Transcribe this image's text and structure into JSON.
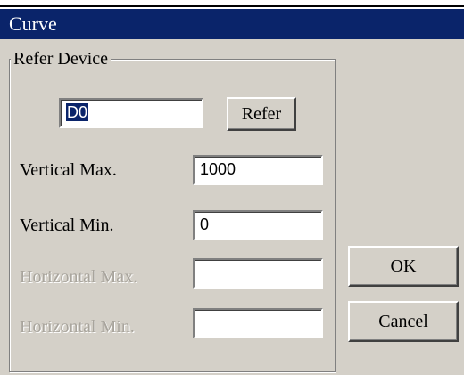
{
  "window": {
    "title": "Curve"
  },
  "refer_group": {
    "legend": "Refer Device",
    "device_value": "D0",
    "refer_button": "Refer"
  },
  "fields": {
    "vertical_max": {
      "label": "Vertical Max.",
      "value": "1000",
      "enabled": true
    },
    "vertical_min": {
      "label": "Vertical Min.",
      "value": "0",
      "enabled": true
    },
    "horizontal_max": {
      "label": "Horizontal Max.",
      "value": "",
      "enabled": false
    },
    "horizontal_min": {
      "label": "Horizontal Min.",
      "value": "",
      "enabled": false
    }
  },
  "buttons": {
    "ok": "OK",
    "cancel": "Cancel"
  },
  "colors": {
    "titlebar": "#0a246a",
    "face": "#d4d0c8",
    "disabled_text": "#a8a49c"
  }
}
